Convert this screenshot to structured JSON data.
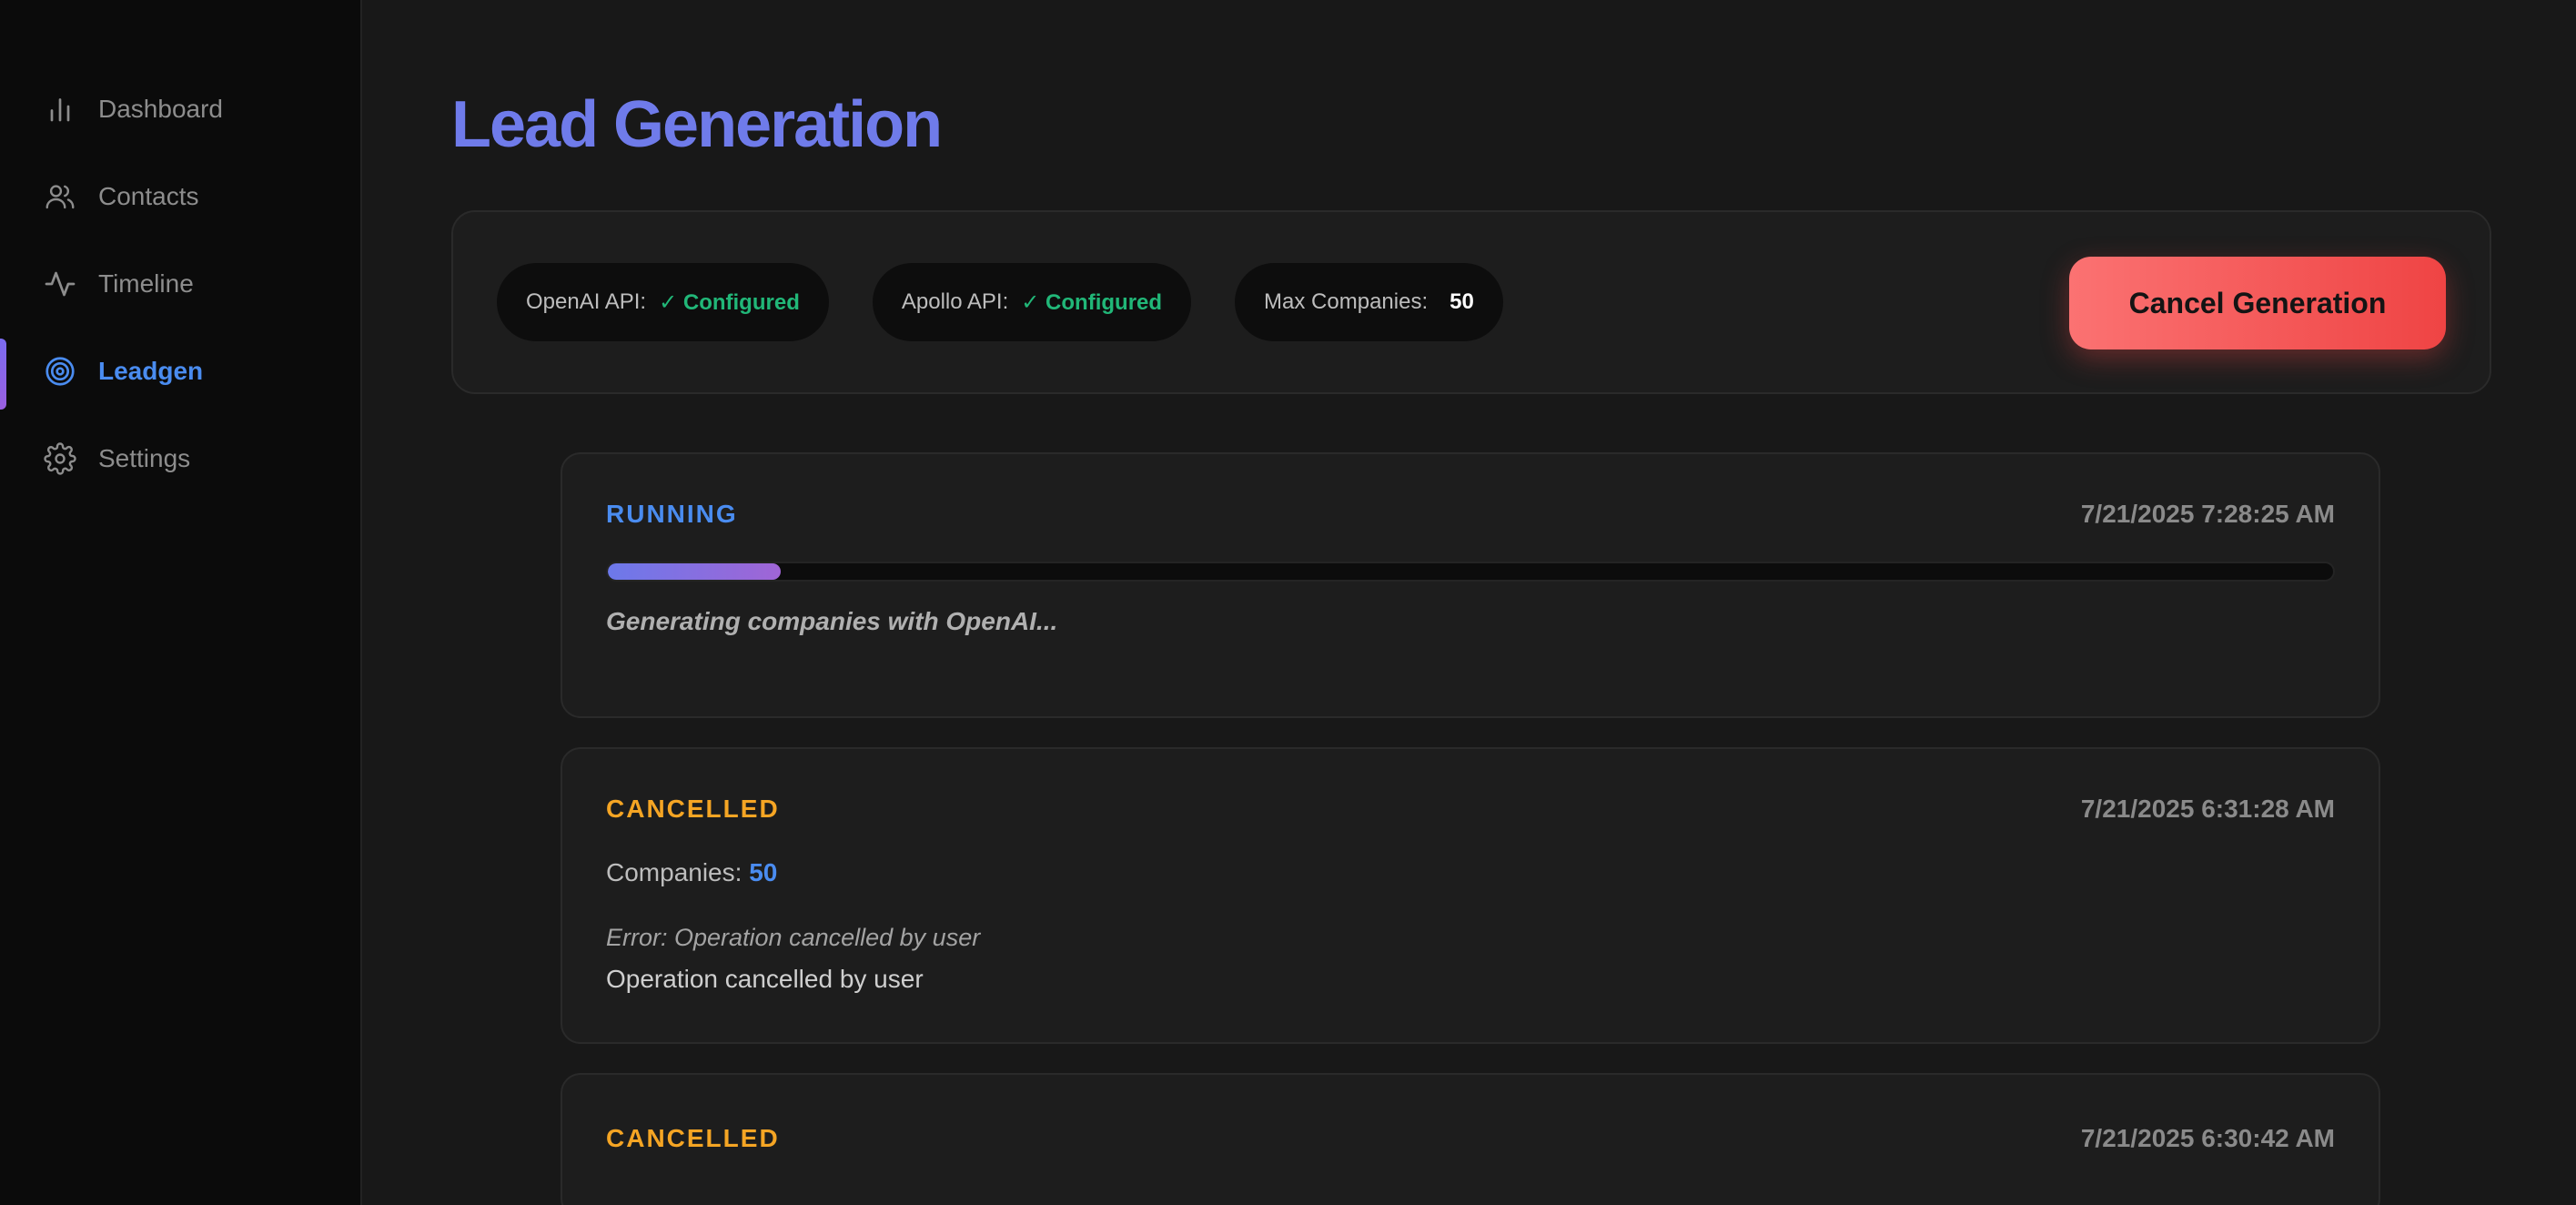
{
  "sidebar": {
    "items": [
      {
        "label": "Dashboard",
        "icon": "bar-chart-icon"
      },
      {
        "label": "Contacts",
        "icon": "users-icon"
      },
      {
        "label": "Timeline",
        "icon": "activity-icon"
      },
      {
        "label": "Leadgen",
        "icon": "target-icon",
        "active": true
      },
      {
        "label": "Settings",
        "icon": "gear-icon"
      }
    ]
  },
  "page": {
    "title": "Lead Generation"
  },
  "config": {
    "openai": {
      "label": "OpenAI API:",
      "status": "✓ Configured"
    },
    "apollo": {
      "label": "Apollo API:",
      "status": "✓ Configured"
    },
    "max": {
      "label": "Max Companies:",
      "value": "50"
    },
    "cancel_label": "Cancel Generation"
  },
  "jobs": [
    {
      "status": "RUNNING",
      "time": "7/21/2025 7:28:25 AM",
      "progress_percent": 10,
      "message": "Generating companies with OpenAI..."
    },
    {
      "status": "CANCELLED",
      "time": "7/21/2025 6:31:28 AM",
      "companies_label": "Companies:",
      "companies": "50",
      "error": "Error: Operation cancelled by user",
      "detail": "Operation cancelled by user"
    },
    {
      "status": "CANCELLED",
      "time": "7/21/2025 6:30:42 AM"
    }
  ],
  "colors": {
    "accent": "#6f7bea",
    "running": "#4a8cf0",
    "cancelled": "#f5a524",
    "configured": "#21b778",
    "danger": "#ef4444"
  }
}
